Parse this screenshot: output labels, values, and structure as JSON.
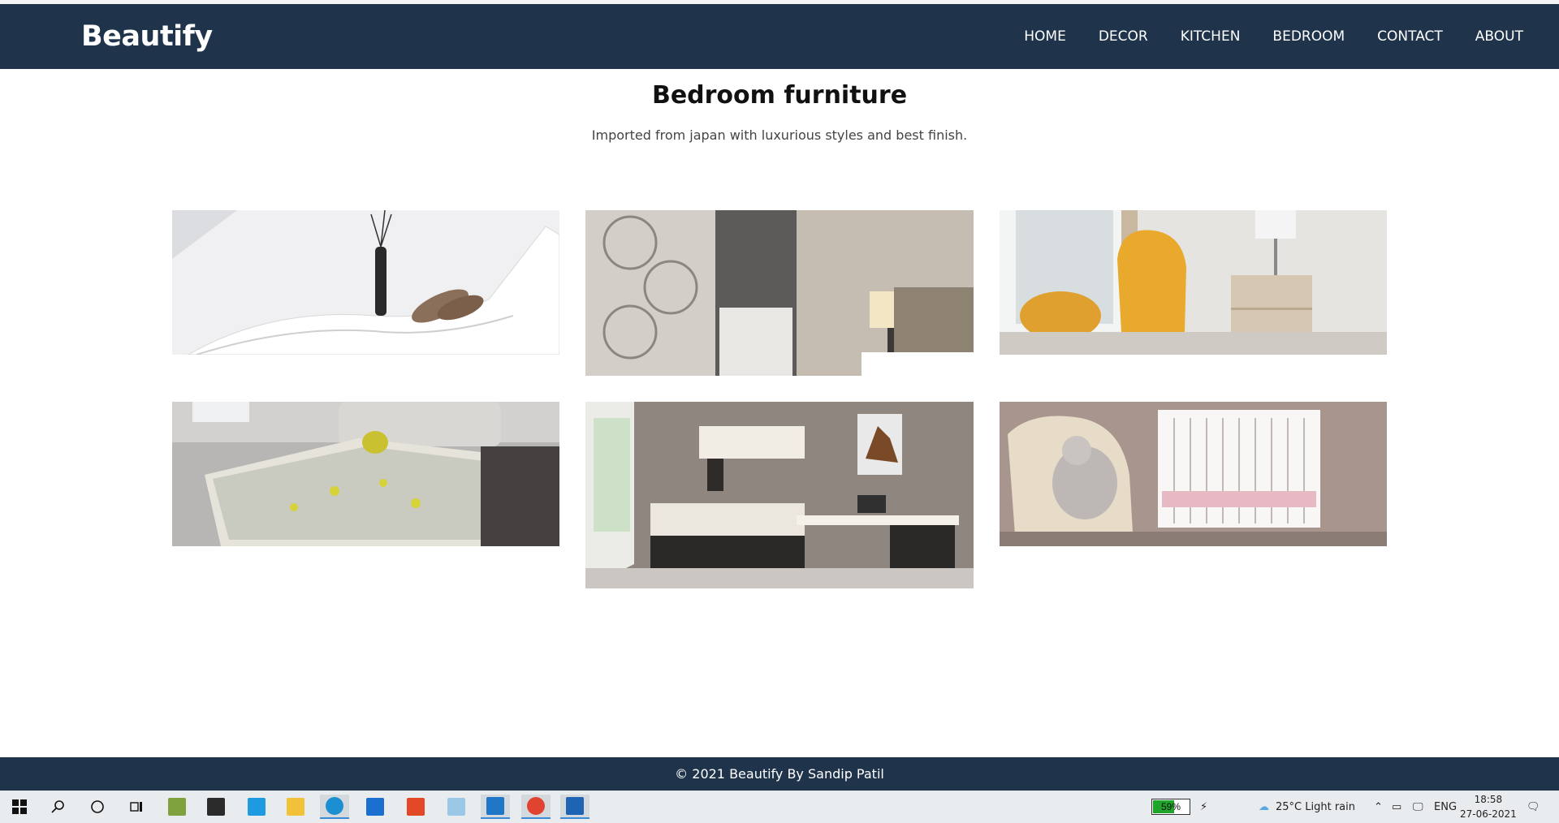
{
  "brand": "Beautify",
  "nav": [
    "HOME",
    "DECOR",
    "KITCHEN",
    "BEDROOM",
    "CONTACT",
    "ABOUT"
  ],
  "page": {
    "title": "Bedroom furniture",
    "subtitle": "Imported from japan with luxurious styles and best finish."
  },
  "gallery": [
    {
      "name": "white-chaise-lounge-photo"
    },
    {
      "name": "wardrobe-room-photo"
    },
    {
      "name": "yellow-armchair-photo"
    },
    {
      "name": "bed-floral-duvet-photo"
    },
    {
      "name": "study-bedroom-photo"
    },
    {
      "name": "nursery-crib-photo"
    }
  ],
  "footer": "© 2021 Beautify By Sandip Patil",
  "taskbar": {
    "battery": "59%",
    "battery_level": 0.59,
    "weather": "25°C  Light rain",
    "language": "ENG",
    "time": "18:58",
    "date": "27-06-2021"
  }
}
